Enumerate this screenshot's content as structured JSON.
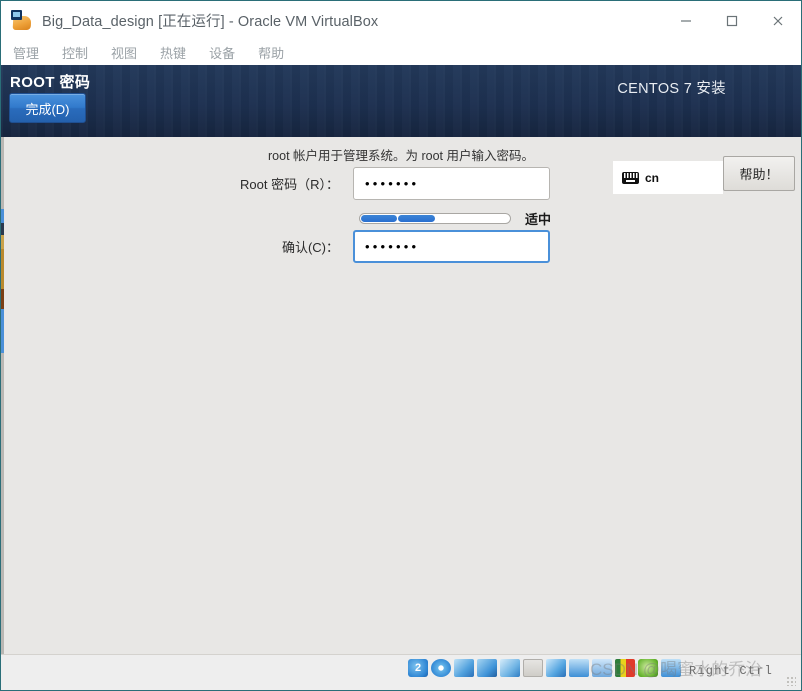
{
  "window": {
    "title": "Big_Data_design [正在运行] - Oracle VM VirtualBox",
    "app_icon": "virtualbox-icon",
    "controls": {
      "minimize": "minimize-icon",
      "maximize": "maximize-icon",
      "close": "close-icon"
    }
  },
  "menubar": {
    "items": [
      {
        "label": "管理"
      },
      {
        "label": "控制"
      },
      {
        "label": "视图"
      },
      {
        "label": "热键"
      },
      {
        "label": "设备"
      },
      {
        "label": "帮助"
      }
    ]
  },
  "installer": {
    "header": {
      "screen_title": "ROOT 密码",
      "done_label": "完成(D)",
      "product_title": "CENTOS 7 安装",
      "keyboard_layout": "cn",
      "keyboard_icon": "keyboard-icon",
      "help_label": "帮助！"
    },
    "body": {
      "intro": "root 帐户用于管理系统。为 root 用户输入密码。",
      "password": {
        "label": "Root 密码（R）：",
        "value": "•••••••",
        "placeholder": ""
      },
      "confirm": {
        "label": "确认(C)：",
        "value": "•••••••",
        "placeholder": ""
      },
      "strength": {
        "label": "适中",
        "segments_total": 4,
        "segments_filled": 2,
        "fill_color": "#2a6fd0"
      }
    }
  },
  "statusbar": {
    "icons": [
      {
        "name": "hard-disk-icon"
      },
      {
        "name": "optical-disk-icon"
      },
      {
        "name": "floppy-disk-icon"
      },
      {
        "name": "network-icon"
      },
      {
        "name": "usb-icon"
      },
      {
        "name": "shared-folder-icon"
      },
      {
        "name": "display-icon"
      },
      {
        "name": "recording-icon"
      },
      {
        "name": "vm-features-icon"
      },
      {
        "name": "activity-bars-icon"
      },
      {
        "name": "mouse-integration-icon"
      },
      {
        "name": "host-key-icon"
      }
    ],
    "host_key": "Right Ctrl"
  },
  "watermark": {
    "text": "CSDN @喝蜜水的乔治"
  }
}
